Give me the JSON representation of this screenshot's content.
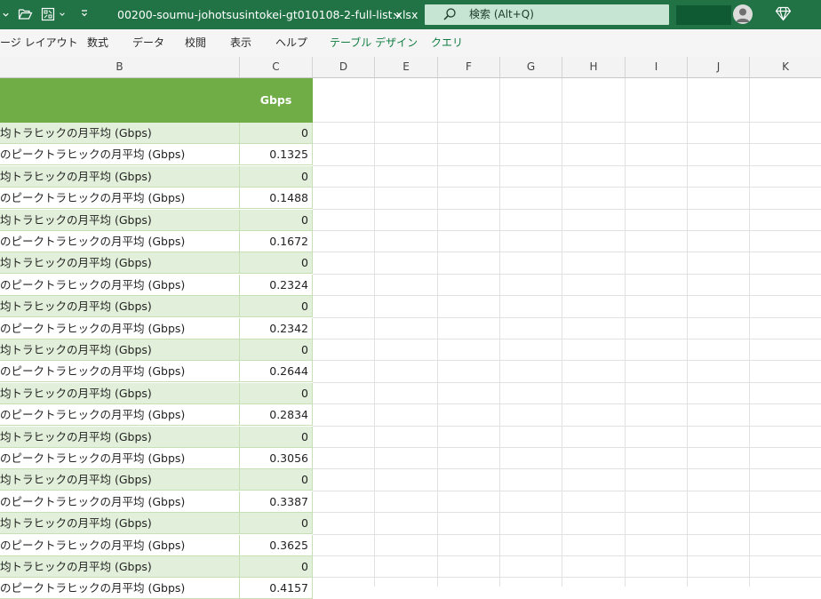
{
  "titlebar": {
    "document_title": "00200-soumu-johotsusintokei-gt010108-2-full-list.xlsx",
    "search_placeholder": "検索 (Alt+Q)",
    "icons": [
      "chevron-down-icon",
      "open-folder-icon",
      "touch-mode-icon",
      "customize-toolbar-icon",
      "search-icon",
      "person-icon",
      "diamond-icon"
    ]
  },
  "ribbon": {
    "tabs": [
      "ージ レイアウト",
      "数式",
      "データ",
      "校閲",
      "表示",
      "ヘルプ",
      "テーブル デザイン",
      "クエリ"
    ]
  },
  "columns": [
    "B",
    "C",
    "D",
    "E",
    "F",
    "G",
    "H",
    "I",
    "J",
    "K"
  ],
  "table": {
    "header_c": "Gbps",
    "rows": [
      {
        "b": "均トラヒックの月平均 (Gbps)",
        "c": "0"
      },
      {
        "b": "のピークトラヒックの月平均 (Gbps)",
        "c": "0.1325"
      },
      {
        "b": "均トラヒックの月平均 (Gbps)",
        "c": "0"
      },
      {
        "b": "のピークトラヒックの月平均 (Gbps)",
        "c": "0.1488"
      },
      {
        "b": "均トラヒックの月平均 (Gbps)",
        "c": "0"
      },
      {
        "b": "のピークトラヒックの月平均 (Gbps)",
        "c": "0.1672"
      },
      {
        "b": "均トラヒックの月平均 (Gbps)",
        "c": "0"
      },
      {
        "b": "のピークトラヒックの月平均 (Gbps)",
        "c": "0.2324"
      },
      {
        "b": "均トラヒックの月平均 (Gbps)",
        "c": "0"
      },
      {
        "b": "のピークトラヒックの月平均 (Gbps)",
        "c": "0.2342"
      },
      {
        "b": "均トラヒックの月平均 (Gbps)",
        "c": "0"
      },
      {
        "b": "のピークトラヒックの月平均 (Gbps)",
        "c": "0.2644"
      },
      {
        "b": "均トラヒックの月平均 (Gbps)",
        "c": "0"
      },
      {
        "b": "のピークトラヒックの月平均 (Gbps)",
        "c": "0.2834"
      },
      {
        "b": "均トラヒックの月平均 (Gbps)",
        "c": "0"
      },
      {
        "b": "のピークトラヒックの月平均 (Gbps)",
        "c": "0.3056"
      },
      {
        "b": "均トラヒックの月平均 (Gbps)",
        "c": "0"
      },
      {
        "b": "のピークトラヒックの月平均 (Gbps)",
        "c": "0.3387"
      },
      {
        "b": "均トラヒックの月平均 (Gbps)",
        "c": "0"
      },
      {
        "b": "のピークトラヒックの月平均 (Gbps)",
        "c": "0.3625"
      },
      {
        "b": "均トラヒックの月平均 (Gbps)",
        "c": "0"
      },
      {
        "b": "のピークトラヒックの月平均 (Gbps)",
        "c": "0.4157"
      }
    ]
  },
  "colors": {
    "titlebar": "#217346",
    "table_header": "#70ad47",
    "band_row": "#e2efda",
    "accent_tab": "#107c41"
  }
}
